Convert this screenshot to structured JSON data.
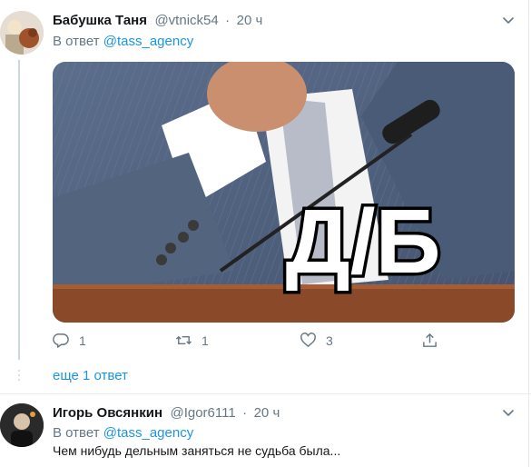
{
  "tweets": [
    {
      "display_name": "Бабушка Таня",
      "handle": "@vtnick54",
      "separator": "·",
      "time": "20 ч",
      "reply_prefix": "В ответ",
      "reply_to": "@tass_agency",
      "media_caption": "Д/Б",
      "actions": {
        "reply_count": "1",
        "retweet_count": "1",
        "like_count": "3"
      },
      "more_replies": "еще 1 ответ"
    },
    {
      "display_name": "Игорь Овсянкин",
      "handle": "@Igor6111",
      "separator": "·",
      "time": "20 ч",
      "reply_prefix": "В ответ",
      "reply_to": "@tass_agency",
      "text": "Чем нибудь дельным заняться не судьба была..."
    }
  ],
  "icons": {
    "reply": "reply-icon",
    "retweet": "retweet-icon",
    "like": "like-icon",
    "share": "share-icon",
    "menu": "chevron-down-icon"
  },
  "colors": {
    "link": "#1b95e0",
    "secondary_text": "#657786",
    "primary_text": "#14171a",
    "thread_line": "#ccd6dd"
  }
}
